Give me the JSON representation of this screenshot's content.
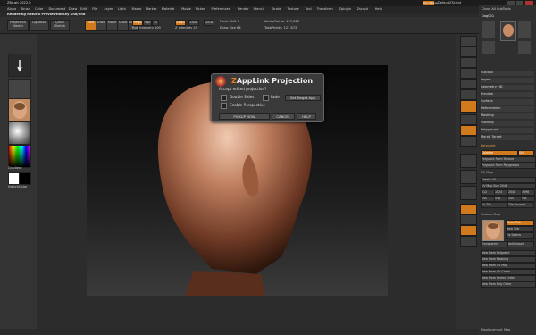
{
  "app": {
    "title": "ZBrush 2022.0",
    "menu": [
      "Alpha",
      "Brush",
      "Color",
      "Document",
      "Draw",
      "Edit",
      "File",
      "Layer",
      "Light",
      "Macro",
      "Marker",
      "Material",
      "Movie",
      "Picker",
      "Preferences",
      "Render",
      "Stencil",
      "Stroke",
      "Texture",
      "Tool",
      "Transform",
      "Zplugin",
      "Zscript",
      "Help"
    ],
    "project_label": "Rendering Natural PreviewHotKey Shd/Shd",
    "quicksave": "QuickSave",
    "default_script": "DefaultZScript"
  },
  "toolbar": {
    "projection_label": "Projection Master",
    "lightbox": "LightBox",
    "quicksketch": "Quick Sketch",
    "edit": "Edit",
    "draw": "Draw",
    "move": "Move",
    "scale": "Scale",
    "rotate": "Rotate",
    "mrgb": "Mrgb",
    "rgb": "Rgb",
    "m": "M",
    "zadd": "Zadd",
    "zsub": "Zsub",
    "zcut": "Zcut",
    "rgb_intensity": "Rgb Intensity 100",
    "z_intensity": "Z Intensity 25",
    "focal_shift": "Focal Shift 0",
    "draw_size": "Draw Size 64",
    "active_points": "ActivePoints: 127,872",
    "total_points": "TotalPoints: 127,872"
  },
  "left_shelf": {
    "gradient_label": "Gradient",
    "switch_color": "SwitchColor"
  },
  "dialog": {
    "title": "ZAppLink Projection",
    "question": "Accept edited projection?",
    "double_sides": "Double Sides",
    "fade": "Fade",
    "set_target_app": "Set Target App",
    "enable_perspective": "Enable Perspective",
    "pickup_now": "PICKUP NOW",
    "cancel": "CANCEL",
    "help": "HELP"
  },
  "tray": {
    "header": "Clone All SubTools",
    "tool_name": "Dog001",
    "sections": [
      "SubTool",
      "Layers",
      "Geometry HD",
      "Preview",
      "Surface",
      "Deformation",
      "Masking",
      "Visibility",
      "Polygroups",
      "Morph Target"
    ],
    "polypaint": "Polypaint",
    "colorize": "Colorize",
    "grd": "Grd",
    "polypaint_texture": "Polypaint From Texture",
    "polypaint_polygroups": "Polypaint From Polygroups",
    "uv_map": "UV Map",
    "uv_items": [
      "Delete UV",
      "UV Map Size 2048",
      "512",
      "1024",
      "2048",
      "4096",
      "Uvc",
      "Uvp",
      "Uvs",
      "Uvt",
      "Uv Tile",
      "Tile Unused"
    ],
    "texture_map": "Texture Map",
    "new_from_items": [
      "New From Polypaint",
      "New From Masking",
      "New From UV Map",
      "New From UV Check",
      "New From Vertex Order",
      "New From Poly Order"
    ],
    "displacement_map": "Displacement Map",
    "transparent": "Transparent",
    "antialiased": "Antialiased",
    "clone_tex": "Clone Txtr",
    "new_txtr": "New Txtr",
    "fix_seams": "Fix Seams"
  },
  "colors": {
    "accent": "#d17a1d",
    "background": "#2b2b2b",
    "panel": "#333333"
  }
}
